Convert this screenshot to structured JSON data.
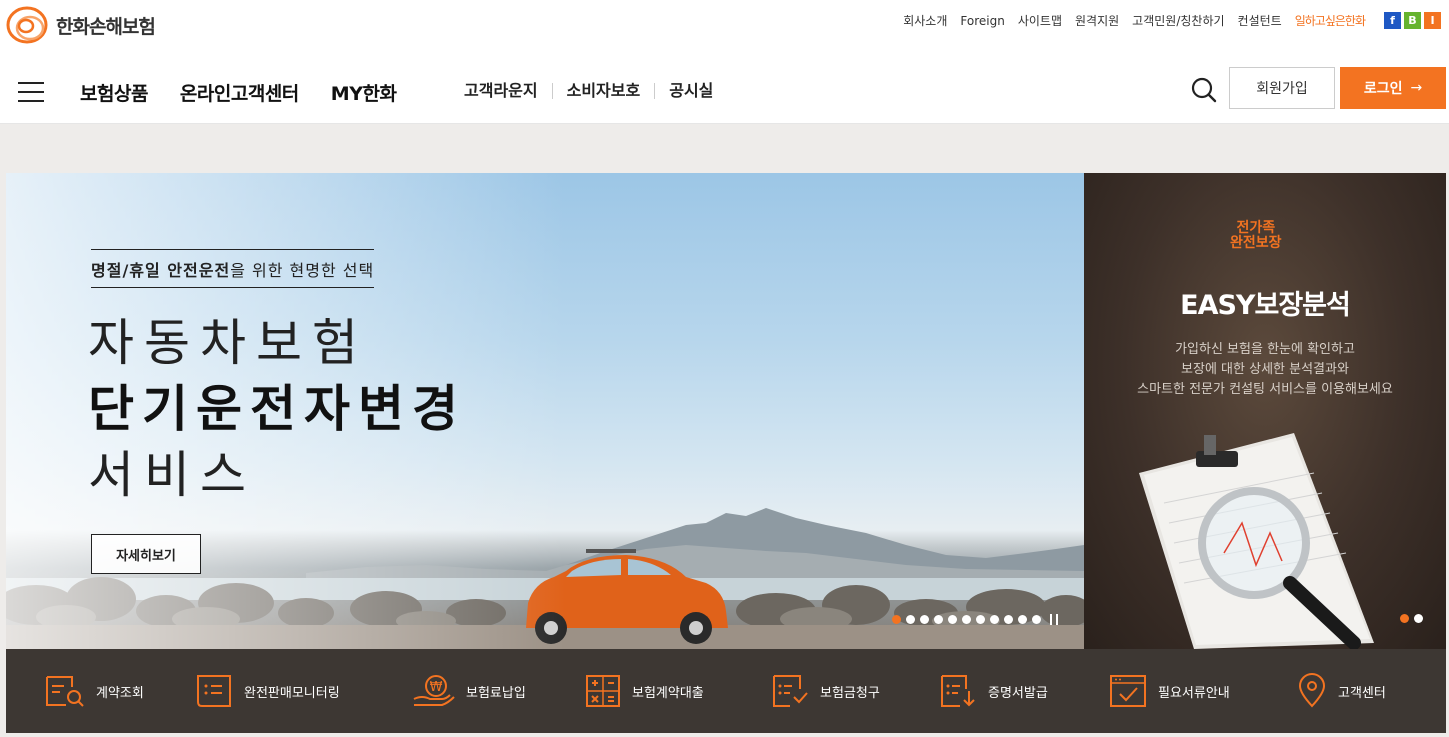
{
  "header": {
    "brand": "한화손해보험",
    "util_links": [
      "회사소개",
      "Foreign",
      "사이트맵",
      "원격지원",
      "고객민원/칭찬하기",
      "컨설턴트"
    ],
    "special_link": "일하고싶은한화",
    "sns": [
      "f",
      "B",
      "I"
    ]
  },
  "nav": {
    "main": [
      "보험상품",
      "온라인고객센터",
      "MY한화"
    ],
    "sub": [
      "고객라운지",
      "소비자보호",
      "공시실"
    ],
    "join_label": "회원가입",
    "login_label": "로그인",
    "login_arrow": "→"
  },
  "hero": {
    "tagline_bold": "명절/휴일 안전운전",
    "tagline_rest": "을 위한 현명한 선택",
    "title_line1": "자동차보험",
    "title_line2": "단기운전자변경",
    "title_line3": "서비스",
    "detail_label": "자세히보기",
    "slide_count": 12,
    "active_slide": 1
  },
  "side_banner": {
    "badge_line1": "전가족",
    "badge_line2": "완전보장",
    "title": "EASY보장분석",
    "desc_line1": "가입하신 보험을 한눈에 확인하고",
    "desc_line2": "보장에 대한 상세한 분석결과와",
    "desc_line3": "스마트한 전문가 컨설팅 서비스를 이용해보세요",
    "slide_count": 2,
    "active_slide": 1
  },
  "quick_menu": [
    {
      "label": "계약조회",
      "icon": "contract-search-icon"
    },
    {
      "label": "완전판매모니터링",
      "icon": "monitoring-list-icon"
    },
    {
      "label": "보험료납입",
      "icon": "won-payment-icon"
    },
    {
      "label": "보험계약대출",
      "icon": "calculator-icon"
    },
    {
      "label": "보험금청구",
      "icon": "claim-check-icon"
    },
    {
      "label": "증명서발급",
      "icon": "certificate-download-icon"
    },
    {
      "label": "필요서류안내",
      "icon": "document-check-icon"
    },
    {
      "label": "고객센터",
      "icon": "location-pin-icon"
    }
  ],
  "colors": {
    "accent": "#f37321",
    "quickbar": "#3d3733",
    "hero_bg": "#eeecea"
  }
}
